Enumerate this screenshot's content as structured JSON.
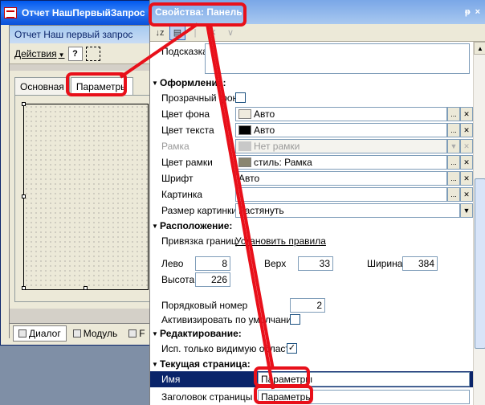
{
  "form_window": {
    "title": "Отчет НашПервыйЗапрос",
    "inner_title": "Отчет  Наш первый запрос",
    "actions_label": "Действия",
    "help_label": "?",
    "tabs": [
      {
        "label": "Основная"
      },
      {
        "label": "Параметры"
      }
    ],
    "bottom_tabs": [
      {
        "label": "Диалог"
      },
      {
        "label": "Модуль"
      },
      {
        "label": "F"
      }
    ]
  },
  "properties": {
    "title": "Свойства: Панель",
    "title_controls": [
      "ᵽ",
      "×"
    ],
    "toolbar": {
      "sort_label": "↓z",
      "clear_label": "✕",
      "check_label": "∨"
    },
    "hint_label": "Подсказка",
    "sections": {
      "appearance": "Оформление:",
      "layout": "Расположение:",
      "editing": "Редактирование:",
      "current_page": "Текущая страница:"
    },
    "appearance": {
      "transparent_label": "Прозрачный фон",
      "bg_color_label": "Цвет фона",
      "bg_color_value": "Авто",
      "text_color_label": "Цвет текста",
      "text_color_value": "Авто",
      "border_label": "Рамка",
      "border_value": "Нет рамки",
      "border_color_label": "Цвет рамки",
      "border_color_value": "стиль: Рамка",
      "font_label": "Шрифт",
      "font_value": "Авто",
      "picture_label": "Картинка",
      "picture_size_label": "Размер картинки",
      "picture_size_value": "Растянуть"
    },
    "layout": {
      "anchor_label": "Привязка границ",
      "anchor_value": "Установить правила",
      "left_label": "Лево",
      "left_value": "8",
      "top_label": "Верх",
      "top_value": "33",
      "width_label": "Ширина",
      "width_value": "384",
      "height_label": "Высота",
      "height_value": "226",
      "order_label": "Порядковый номер",
      "order_value": "2",
      "default_label": "Активизировать по умолчанию"
    },
    "editing": {
      "visible_only_label": "Исп. только видимую область"
    },
    "current_page": {
      "name_label": "Имя",
      "name_value": "Параметры",
      "header_label": "Заголовок страницы",
      "header_value": "Параметры"
    }
  },
  "colors": {
    "annotation": "#e8101a",
    "selection": "#0a246a",
    "swatch_bg": "#efebde",
    "swatch_text": "#000000",
    "swatch_border_disabled": "#c8c8c8",
    "swatch_border_color": "#8a8670"
  }
}
